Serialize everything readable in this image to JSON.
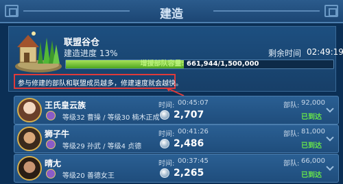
{
  "window": {
    "title": "建造"
  },
  "building": {
    "name": "联盟谷仓",
    "progress_label": "建造进度 13%",
    "progress": 0.13,
    "remaining_label": "剩余时间",
    "remaining_value": "02:49:19",
    "capacity_label": "增援部队容量:",
    "capacity_value": "661,944/1,500,000",
    "capacity_fraction": 0.441
  },
  "hint": "参与修建的部队和联盟成员越多，修建速度就会越快。",
  "rows": [
    {
      "name": "王氏皇云族",
      "level": "等级32 曹操 / 等级30 楠木正成",
      "time_label": "时间:",
      "time": "00:45:07",
      "amount": "2,707",
      "troops_label": "部队:",
      "troops": "92,000",
      "status": "已到达"
    },
    {
      "name": "狮子牛",
      "level": "等级29 孙武 / 等级4 贞德",
      "time_label": "时间:",
      "time": "00:41:26",
      "amount": "2,486",
      "troops_label": "部队:",
      "troops": "81,000",
      "status": "已到达"
    },
    {
      "name": "晴尢",
      "level": "等级20 善德女王",
      "time_label": "时间:",
      "time": "00:37:45",
      "amount": "2,265",
      "troops_label": "部队:",
      "troops": "66,000",
      "status": "已到达"
    }
  ],
  "colors": {
    "background": "#0b2f55",
    "accent_green": "#67e44a",
    "highlight_red": "#e03a3a"
  }
}
